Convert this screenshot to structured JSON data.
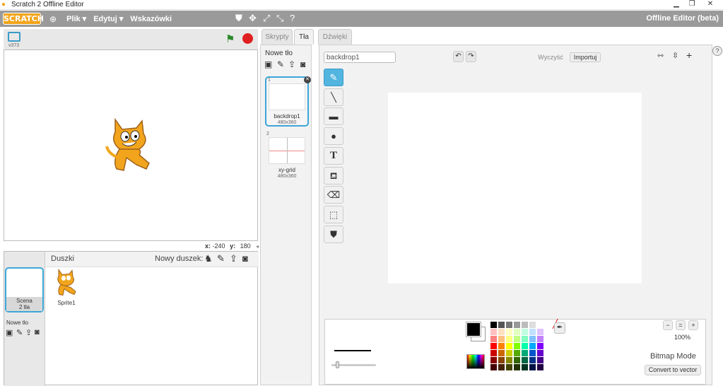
{
  "window": {
    "title": "Scratch 2 Offline Editor"
  },
  "menubar": {
    "logo": "SCRATCH",
    "items": [
      "Plik ▾",
      "Edytuj ▾",
      "Wskazówki"
    ],
    "right_label": "Offline Editor (beta)"
  },
  "stage": {
    "version": "v373",
    "coord_x_label": "x:",
    "coord_x_value": "-240",
    "coord_y_label": "y:",
    "coord_y_value": "180"
  },
  "sprites": {
    "header_label": "Duszki",
    "new_sprite_label": "Nowy duszek:",
    "scene_label": "Scena",
    "scene_count": "2 tła",
    "new_backdrop_label": "Nowe tło",
    "items": [
      {
        "name": "Sprite1"
      }
    ]
  },
  "editor": {
    "tabs": [
      "Skrypty",
      "Tła",
      "Dźwięki"
    ],
    "active_tab": "Tła",
    "new_backdrop_label": "Nowe tło",
    "costumes": [
      {
        "index": "1",
        "name": "backdrop1",
        "size": "480x360"
      },
      {
        "index": "2",
        "name": "xy-grid",
        "size": "480x360"
      }
    ],
    "name_field_value": "backdrop1",
    "clear_label": "Wyczyść",
    "import_label": "Importuj",
    "zoom_level": "100%",
    "mode_label": "Bitmap Mode",
    "convert_label": "Convert to vector"
  },
  "colors": {
    "accent_blue": "#52b5e0",
    "menubar_gray": "#9a9a9a",
    "panel_gray": "#f2f2f2",
    "selected_costume_border": "#3ca6d8",
    "palette": [
      "#000000",
      "#555555",
      "#777777",
      "#999999",
      "#bbbbbb",
      "#dddddd",
      "#ffffff",
      "#ffc0c0",
      "#ffe0c0",
      "#ffffc0",
      "#e0ffc0",
      "#c0ffe0",
      "#c0e0ff",
      "#e0c0ff",
      "#ff8080",
      "#ffc080",
      "#ffff80",
      "#c0ff80",
      "#80ffc0",
      "#80c0ff",
      "#c080ff",
      "#ff0000",
      "#ff8000",
      "#ffff00",
      "#80ff00",
      "#00ffaa",
      "#00aaff",
      "#8000ff",
      "#cc0000",
      "#cc6600",
      "#cccc00",
      "#55aa00",
      "#00aa77",
      "#0055cc",
      "#6600cc",
      "#880000",
      "#884400",
      "#888800",
      "#336600",
      "#006644",
      "#003388",
      "#440088",
      "#440000",
      "#442200",
      "#444400",
      "#223300",
      "#003322",
      "#001144",
      "#220044"
    ]
  }
}
